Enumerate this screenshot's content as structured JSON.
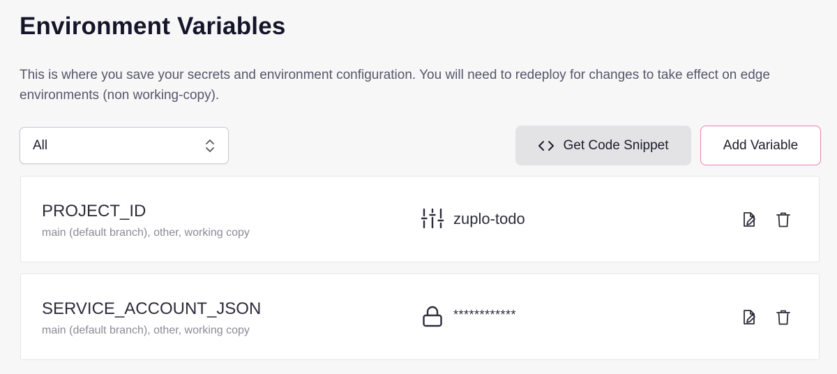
{
  "header": {
    "title": "Environment Variables",
    "description": "This is where you save your secrets and environment configuration. You will need to redeploy for changes to take effect on edge environments (non working-copy)."
  },
  "filter": {
    "selected": "All",
    "icon": "chevrons-up-down-icon"
  },
  "toolbar": {
    "snippet_label": "Get Code Snippet",
    "snippet_icon": "code-icon",
    "add_label": "Add Variable",
    "add_border_color": "#e87fb4"
  },
  "variables": [
    {
      "name": "PROJECT_ID",
      "branches": "main (default branch), other, working copy",
      "type_icon": "sliders-icon",
      "value": "zuplo-todo"
    },
    {
      "name": "SERVICE_ACCOUNT_JSON",
      "branches": "main (default branch), other, working copy",
      "type_icon": "lock-icon",
      "value": "************"
    }
  ]
}
